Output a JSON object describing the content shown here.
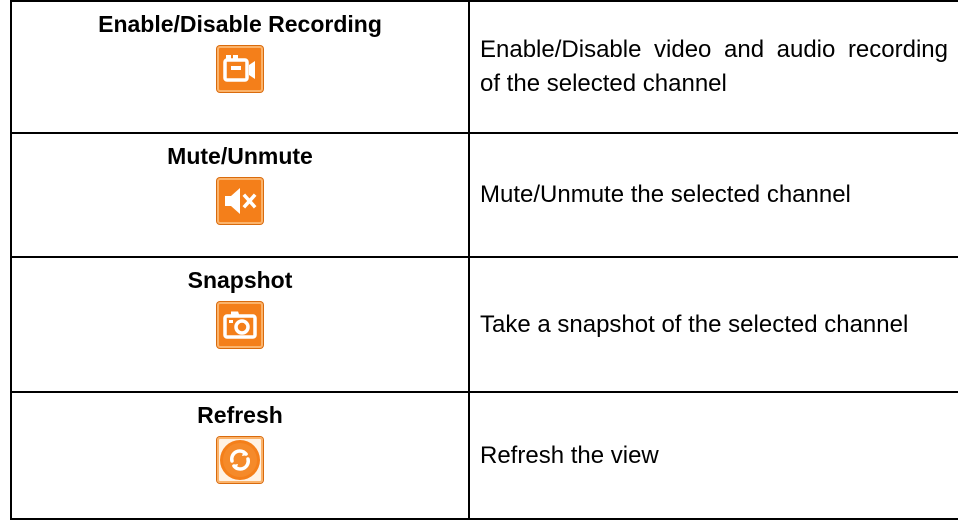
{
  "rows": [
    {
      "name": "Enable/Disable Recording",
      "icon": "video-camera-icon",
      "description": "Enable/Disable video and audio recording of the selected channel"
    },
    {
      "name": "Mute/Unmute",
      "icon": "speaker-mute-icon",
      "description": "Mute/Unmute the selected channel"
    },
    {
      "name": "Snapshot",
      "icon": "camera-icon",
      "description": "Take a snapshot of the selected channel"
    },
    {
      "name": "Refresh",
      "icon": "refresh-icon",
      "description": "Refresh the view"
    }
  ],
  "colors": {
    "icon_background": "#f47f1a",
    "icon_glyph": "#ffffff",
    "border": "#000000"
  }
}
